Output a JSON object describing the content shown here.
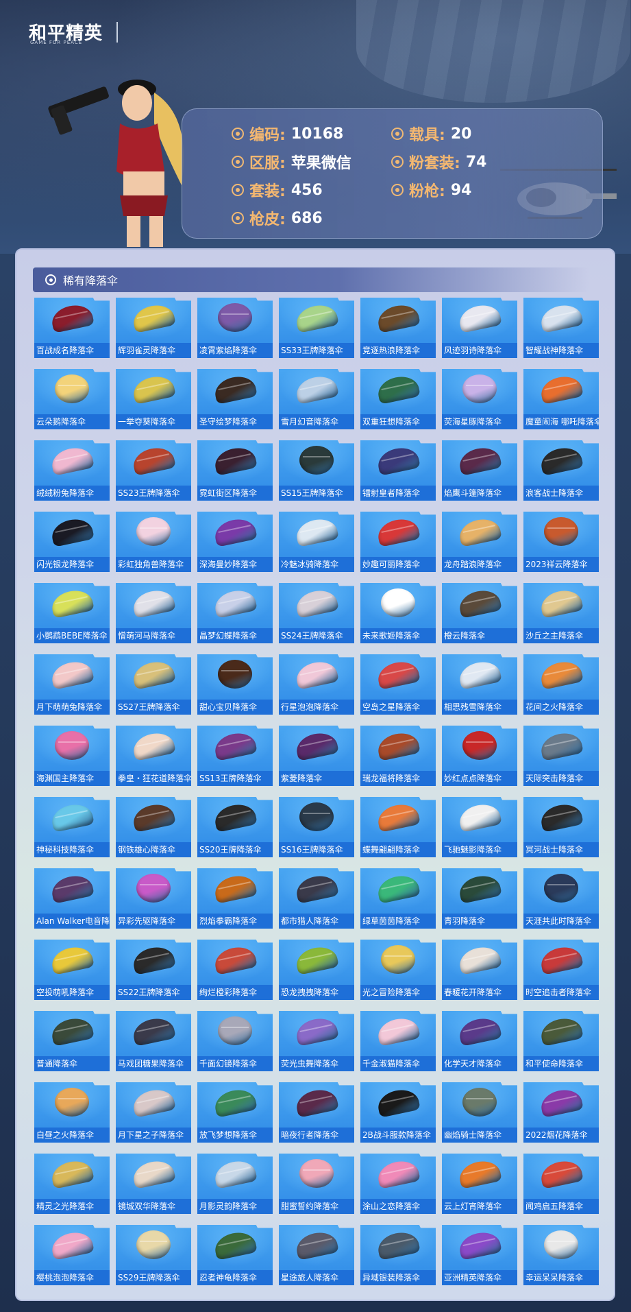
{
  "brand": {
    "logo_text": "和平精英",
    "logo_sub": "GAME FOR PEACE"
  },
  "colors": {
    "accent": "#f5b870",
    "card_blue": "#2f8ae6",
    "section_bar": "#4a5c9c"
  },
  "profile": {
    "id_label": "编码:",
    "id_value": "10168",
    "server_label": "区服:",
    "server_value": "苹果微信",
    "outfit_label": "套装:",
    "outfit_value": "456",
    "skin_label": "枪皮:",
    "skin_value": "686",
    "vehicle_label": "载具:",
    "vehicle_value": "20",
    "pink_outfit_label": "粉套装:",
    "pink_outfit_value": "74",
    "pink_gun_label": "粉枪:",
    "pink_gun_value": "94"
  },
  "section": {
    "title": "稀有降落伞"
  },
  "items": [
    {
      "label": "百战成名降落伞",
      "color": "#8b1d2c"
    },
    {
      "label": "辉羽雀灵降落伞",
      "color": "#e0c64a"
    },
    {
      "label": "凌霄紫焰降落伞",
      "color": "#7d5aa8"
    },
    {
      "label": "SS33王牌降落伞",
      "color": "#a8d48a"
    },
    {
      "label": "竞逐热浪降落伞",
      "color": "#6b4a2a"
    },
    {
      "label": "风迹羽诗降落伞",
      "color": "#e8e8f0"
    },
    {
      "label": "智耀战神降落伞",
      "color": "#d8e2ee"
    },
    {
      "label": "云朵鹅降落伞",
      "color": "#f3d37a"
    },
    {
      "label": "一举夺葵降落伞",
      "color": "#d9c44e"
    },
    {
      "label": "圣守绘梦降落伞",
      "color": "#3a2a22"
    },
    {
      "label": "雪月幻音降落伞",
      "color": "#bcd0e6"
    },
    {
      "label": "双重狂想降落伞",
      "color": "#2e6e4a"
    },
    {
      "label": "荧海星豚降落伞",
      "color": "#c9b2e8"
    },
    {
      "label": "魔童闹海 哪吒降落伞",
      "color": "#e86e2e"
    },
    {
      "label": "绒绒粉兔降落伞",
      "color": "#f0b8d0"
    },
    {
      "label": "SS23王牌降落伞",
      "color": "#b8442e"
    },
    {
      "label": "霓虹街区降落伞",
      "color": "#3a2030"
    },
    {
      "label": "SS15王牌降落伞",
      "color": "#2a3a3a"
    },
    {
      "label": "镭射皇者降落伞",
      "color": "#3a3a7a"
    },
    {
      "label": "焰鹰斗篷降落伞",
      "color": "#5a2a4a"
    },
    {
      "label": "浪客战士降落伞",
      "color": "#2a2a2a"
    },
    {
      "label": "闪光银龙降落伞",
      "color": "#1a1a24"
    },
    {
      "label": "彩虹独角兽降落伞",
      "color": "#f2d2e0"
    },
    {
      "label": "深海曼妙降落伞",
      "color": "#7a3aa8"
    },
    {
      "label": "冷魅冰骑降落伞",
      "color": "#dde8f2"
    },
    {
      "label": "妙趣可丽降落伞",
      "color": "#d83838"
    },
    {
      "label": "龙舟踏浪降落伞",
      "color": "#e6b268"
    },
    {
      "label": "2023祥云降落伞",
      "color": "#c85a2e"
    },
    {
      "label": "小鹦鹉BEBE降落伞",
      "color": "#d8e05a"
    },
    {
      "label": "憎萌河马降落伞",
      "color": "#e0e0e8"
    },
    {
      "label": "晶梦幻蝶降落伞",
      "color": "#c8d0e8"
    },
    {
      "label": "SS24王牌降落伞",
      "color": "#d8d0d8"
    },
    {
      "label": "未来歌姬降落伞",
      "color": "#ffffff"
    },
    {
      "label": "橙云降落伞",
      "color": "#5a4a3a"
    },
    {
      "label": "沙丘之主降落伞",
      "color": "#e0c890"
    },
    {
      "label": "月下萌萌兔降落伞",
      "color": "#f2c8c8"
    },
    {
      "label": "SS27王牌降落伞",
      "color": "#d8c07a"
    },
    {
      "label": "甜心宝贝降落伞",
      "color": "#4a2a1a"
    },
    {
      "label": "行星泡泡降落伞",
      "color": "#f0c8d8"
    },
    {
      "label": "空岛之星降落伞",
      "color": "#d84848"
    },
    {
      "label": "相思残雪降落伞",
      "color": "#e0e8f2"
    },
    {
      "label": "花间之火降落伞",
      "color": "#e88a3a"
    },
    {
      "label": "海渊国主降落伞",
      "color": "#e870a8"
    },
    {
      "label": "拳皇・狂花道降落伞",
      "color": "#f0d8c8"
    },
    {
      "label": "SS13王牌降落伞",
      "color": "#7a3a8a"
    },
    {
      "label": "紫菱降落伞",
      "color": "#5a2a6a"
    },
    {
      "label": "瑞龙福将降落伞",
      "color": "#a84a2a"
    },
    {
      "label": "妙红点点降落伞",
      "color": "#c82828"
    },
    {
      "label": "天际突击降落伞",
      "color": "#6a7a8a"
    },
    {
      "label": "神秘科技降落伞",
      "color": "#68c8e8"
    },
    {
      "label": "钢铁雄心降落伞",
      "color": "#5a3a2a"
    },
    {
      "label": "SS20王牌降落伞",
      "color": "#2a2a2a"
    },
    {
      "label": "SS16王牌降落伞",
      "color": "#2a3a4a"
    },
    {
      "label": "蝶舞翩翩降落伞",
      "color": "#e87a3a"
    },
    {
      "label": "飞驰魅影降落伞",
      "color": "#f0f0f0"
    },
    {
      "label": "冥河战士降落伞",
      "color": "#2a2a2a"
    },
    {
      "label": "Alan Walker电音降落伞",
      "color": "#5a3a6a"
    },
    {
      "label": "异彩先驱降落伞",
      "color": "#c85ac8"
    },
    {
      "label": "烈焰拳霸降落伞",
      "color": "#c86a1a"
    },
    {
      "label": "都市猎人降落伞",
      "color": "#3a3a4a"
    },
    {
      "label": "绿草茵茵降落伞",
      "color": "#3ab87a"
    },
    {
      "label": "青羽降落伞",
      "color": "#2a4a3a"
    },
    {
      "label": "天涯共此时降落伞",
      "color": "#2a3a5a"
    },
    {
      "label": "空投萌吼降落伞",
      "color": "#e8c83a"
    },
    {
      "label": "SS22王牌降落伞",
      "color": "#2a2a2a"
    },
    {
      "label": "绚烂橙彩降落伞",
      "color": "#c84a3a"
    },
    {
      "label": "恐龙拽拽降落伞",
      "color": "#8ab83a"
    },
    {
      "label": "光之冒险降落伞",
      "color": "#e8c85a"
    },
    {
      "label": "春暖花开降落伞",
      "color": "#e8e0d8"
    },
    {
      "label": "时空追击者降落伞",
      "color": "#c83a3a"
    },
    {
      "label": "普通降落伞",
      "color": "#3a4a3a"
    },
    {
      "label": "马戏团糖果降落伞",
      "color": "#3a3a4a"
    },
    {
      "label": "千面幻镜降落伞",
      "color": "#a8a8b8"
    },
    {
      "label": "荧光虫舞降落伞",
      "color": "#8a6ac8"
    },
    {
      "label": "千金淑猫降落伞",
      "color": "#f2c8d8"
    },
    {
      "label": "化学天才降落伞",
      "color": "#5a3a8a"
    },
    {
      "label": "和平使命降落伞",
      "color": "#4a5a3a"
    },
    {
      "label": "白昼之火降落伞",
      "color": "#e8a85a"
    },
    {
      "label": "月下星之子降落伞",
      "color": "#d8c8c8"
    },
    {
      "label": "放飞梦想降落伞",
      "color": "#3a8a5a"
    },
    {
      "label": "暗夜行者降落伞",
      "color": "#5a2a4a"
    },
    {
      "label": "2B战斗服款降落伞",
      "color": "#1a1a1a"
    },
    {
      "label": "幽焰骑士降落伞",
      "color": "#6a7a6a"
    },
    {
      "label": "2022烟花降落伞",
      "color": "#8a3aa8"
    },
    {
      "label": "精灵之光降落伞",
      "color": "#d8b85a"
    },
    {
      "label": "镜城双华降落伞",
      "color": "#e8d8c8"
    },
    {
      "label": "月影灵韵降落伞",
      "color": "#c8d8e8"
    },
    {
      "label": "甜蜜誓约降落伞",
      "color": "#f0a8b8"
    },
    {
      "label": "涂山之恋降落伞",
      "color": "#f08ab8"
    },
    {
      "label": "云上灯宵降落伞",
      "color": "#e87a2a"
    },
    {
      "label": "闻鸡启五降落伞",
      "color": "#d84a3a"
    },
    {
      "label": "樱桃泡泡降落伞",
      "color": "#f0a8c8"
    },
    {
      "label": "SS29王牌降落伞",
      "color": "#e8d8a8"
    },
    {
      "label": "忍者神龟降落伞",
      "color": "#3a6a3a"
    },
    {
      "label": "星途旅人降落伞",
      "color": "#5a5a6a"
    },
    {
      "label": "异域银装降落伞",
      "color": "#4a5a6a"
    },
    {
      "label": "亚洲精英降落伞",
      "color": "#8a4ac8"
    },
    {
      "label": "幸运呆呆降落伞",
      "color": "#e8e8e8"
    }
  ]
}
